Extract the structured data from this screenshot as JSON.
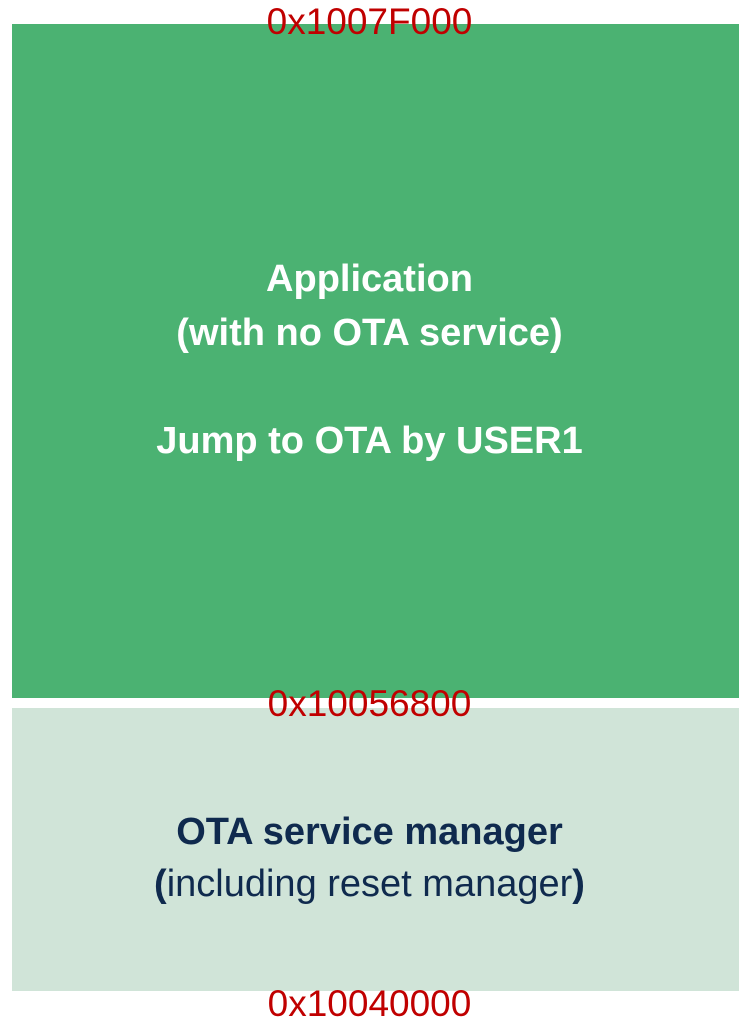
{
  "colors": {
    "application_fill": "#4BB272",
    "ota_fill": "#D0E4D8",
    "address_text": "#C00000",
    "application_text": "#FFFFFF",
    "ota_text": "#0F2A4E"
  },
  "memory_map": {
    "addresses": {
      "top": "0x1007F000",
      "middle": "0x10056800",
      "bottom": "0x10040000"
    },
    "application": {
      "line1": "Application",
      "line2": "(with no OTA service)",
      "line3": "Jump to OTA by USER1"
    },
    "ota": {
      "title": "OTA service manager",
      "open_paren": "(",
      "subtitle": "including reset manager",
      "close_paren": ")"
    }
  }
}
